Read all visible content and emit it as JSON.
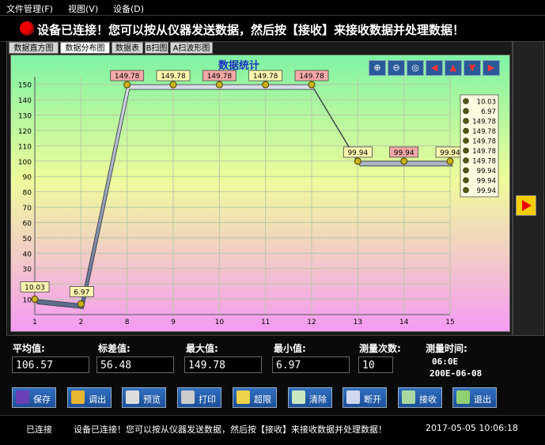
{
  "menu": [
    "文件管理(F)",
    "视图(V)",
    "设备(D)"
  ],
  "banner": "设备已连接！您可以按从仪器发送数据，然后按【接收】来接收数据并处理数据！",
  "tabs": [
    "数据直方图",
    "数据分布图",
    "数据表",
    "B扫图",
    "A扫波形图"
  ],
  "active_tab": 1,
  "toolbar_icons": [
    "zoom-in-icon",
    "zoom-out-icon",
    "zoom-reset-icon",
    "arrow-left-icon",
    "arrow-up-icon",
    "arrow-down-icon",
    "arrow-right-icon"
  ],
  "chart_data": {
    "type": "line",
    "title": "数据统计",
    "categories": [
      "1",
      "2",
      "8",
      "9",
      "10",
      "11",
      "12",
      "13",
      "14",
      "15"
    ],
    "values": [
      10.03,
      6.97,
      149.78,
      149.78,
      149.78,
      149.78,
      149.78,
      99.94,
      99.94,
      99.94
    ],
    "data_labels": [
      "10.03",
      "6.97",
      "149.78",
      "149.78",
      "149.78",
      "149.78",
      "149.78",
      "99.94",
      "99.94",
      "99.94"
    ],
    "yticks": [
      "10",
      "20",
      "30",
      "40",
      "50",
      "60",
      "70",
      "80",
      "90",
      "100",
      "110",
      "120",
      "130",
      "140",
      "150"
    ],
    "ylim": [
      0,
      155
    ],
    "grid": true,
    "legend_position": "right",
    "legend": [
      "10.03",
      "6.97",
      "149.78",
      "149.78",
      "149.78",
      "149.78",
      "149.78",
      "99.94",
      "99.94",
      "99.94"
    ]
  },
  "stats": {
    "avg_label": "平均值:",
    "avg": "106.57",
    "std_label": "标差值:",
    "std": "56.48",
    "max_label": "最大值:",
    "max": "149.78",
    "min_label": "最小值:",
    "min": "6.97",
    "count_label": "测量次数:",
    "count": "10",
    "time_label": "测量时间:",
    "time": "06:0E",
    "date": "200E-06-08"
  },
  "buttons": [
    {
      "name": "save-button",
      "icon": "floppy-icon",
      "label": "保存",
      "color": "#6a3fb5"
    },
    {
      "name": "load-button",
      "icon": "folder-icon",
      "label": "调出",
      "color": "#e8b530"
    },
    {
      "name": "preview-button",
      "icon": "magnifier-icon",
      "label": "预览",
      "color": "#dddddd"
    },
    {
      "name": "print-button",
      "icon": "printer-icon",
      "label": "打印",
      "color": "#cccccc"
    },
    {
      "name": "limit-button",
      "icon": "limit-icon",
      "label": "超限",
      "color": "#f0d24a"
    },
    {
      "name": "clear-button",
      "icon": "recycle-icon",
      "label": "清除",
      "color": "#c8e8c0"
    },
    {
      "name": "disconnect-button",
      "icon": "disconnect-icon",
      "label": "断开",
      "color": "#d0d8f0"
    },
    {
      "name": "receive-button",
      "icon": "receive-icon",
      "label": "接收",
      "color": "#a8d8a0"
    },
    {
      "name": "exit-button",
      "icon": "exit-icon",
      "label": "退出",
      "color": "#8fd070"
    }
  ],
  "status_bar": {
    "conn": "已连接",
    "message": "设备已连接！您可以按从仪器发送数据，然后按【接收】来接收数据并处理数据！",
    "datetime": "2017-05-05 10:06:18"
  }
}
